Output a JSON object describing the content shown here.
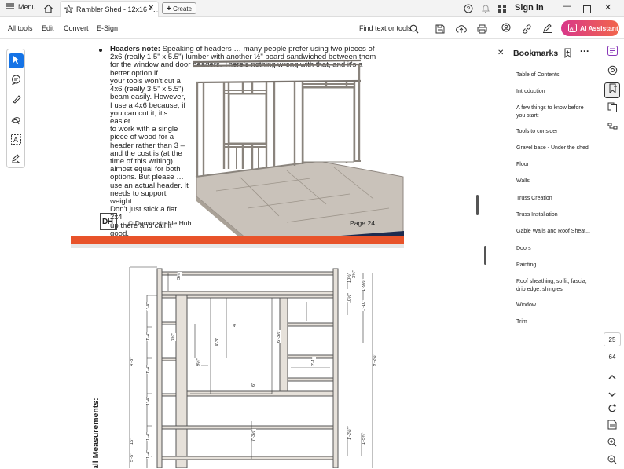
{
  "titlebar": {
    "menu_label": "Menu",
    "tab_title": "Rambler Shed - 12x16 - ...",
    "create_label": "Create",
    "sign_in_label": "Sign in"
  },
  "toolbar": {
    "all_tools": "All tools",
    "edit": "Edit",
    "convert": "Convert",
    "esign": "E-Sign",
    "find_label": "Find text or tools",
    "ai_label": "AI Assistant"
  },
  "page1": {
    "note_bold": "Headers note:",
    "note_wide": " Speaking of headers … many people prefer using two pieces of 2x6 (really 1.5\" x 5.5\") lumber with another ½\" board sandwiched between them for the window and door headers.  There's nothing wrong with that, and it's a better option if",
    "note_narrow": [
      "your tools won't cut a",
      "4x6 (really 3.5\" x 5.5\")",
      "beam easily.  However,",
      "I use a 4x6 because, if",
      "you can cut it, it's easier",
      "to work with a single",
      "piece of wood for a",
      "header rather than 3 –",
      "and the cost is (at the",
      "time of this writing)",
      "almost equal for both",
      "options.  But please …",
      "use an actual header. It",
      "needs to support weight.",
      "Don't just stick a flat 2x4",
      "up there and call it",
      "good."
    ],
    "logo_text": "DH",
    "copyright": "© Demonstrable Hub",
    "page_label": "Page 24"
  },
  "page2": {
    "side_title": "all Measurements:",
    "dims": [
      "3¼\"",
      "3¾\"",
      "1'-4\"",
      "1'-4\"",
      "1'-4\"",
      "1'-4\"",
      "1'-4\"",
      "1'-4\"",
      "4'-3\"",
      "16\"",
      "5'-5\"",
      "7¾\"",
      "4'-3\"",
      "4'",
      "9½\"",
      "6'-3½\"",
      "6'",
      "2'-1\"",
      "10½\"",
      "10½\"",
      "1'-9½\"",
      "1'-10\"",
      "9'-2½\"",
      "7'-3½\"",
      "1'-2½\"",
      "1'-5¾\""
    ]
  },
  "bookmarks": {
    "title": "Bookmarks",
    "items": [
      "Table of Contents",
      "Introduction",
      "A few things to know before",
      "you start:",
      "Tools to consider",
      "Gravel base - Under the shed",
      "Floor",
      "Walls",
      "Truss Creation",
      "Truss Installation",
      "Gable Walls and Roof Sheat...",
      "Doors",
      "Painting",
      "Roof sheathing, soffit, fascia,",
      "drip edge, shingles",
      "Window",
      "Trim"
    ]
  },
  "pagenav": {
    "current": "25",
    "total": "64"
  },
  "colors": {
    "accent": "#1473e6",
    "orange": "#e8532a",
    "navy": "#1d2b4f",
    "ai_gradient_start": "#d8378a",
    "ai_gradient_end": "#f2664b"
  }
}
